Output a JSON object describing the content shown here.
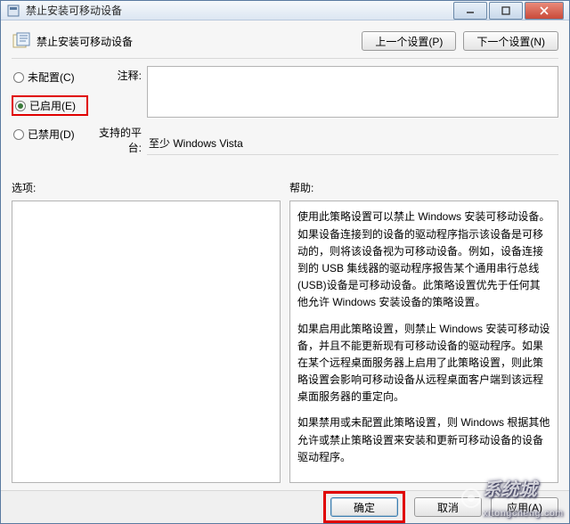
{
  "window": {
    "title": "禁止安装可移动设备"
  },
  "header": {
    "title": "禁止安装可移动设备",
    "prev_btn": "上一个设置(P)",
    "next_btn": "下一个设置(N)"
  },
  "radios": {
    "not_configured": "未配置(C)",
    "enabled": "已启用(E)",
    "disabled": "已禁用(D)",
    "selected": "enabled"
  },
  "fields": {
    "comment_label": "注释:",
    "comment_value": "",
    "platform_label": "支持的平台:",
    "platform_value": "至少 Windows Vista"
  },
  "lower": {
    "options_label": "选项:",
    "help_label": "帮助:",
    "help_paragraphs": [
      "使用此策略设置可以禁止 Windows 安装可移动设备。如果设备连接到的设备的驱动程序指示该设备是可移动的，则将该设备视为可移动设备。例如，设备连接到的 USB 集线器的驱动程序报告某个通用串行总线(USB)设备是可移动设备。此策略设置优先于任何其他允许 Windows 安装设备的策略设置。",
      "如果启用此策略设置，则禁止 Windows 安装可移动设备，并且不能更新现有可移动设备的驱动程序。如果在某个远程桌面服务器上启用了此策略设置，则此策略设置会影响可移动设备从远程桌面客户端到该远程桌面服务器的重定向。",
      "如果禁用或未配置此策略设置，则 Windows 根据其他允许或禁止策略设置来安装和更新可移动设备的设备驱动程序。"
    ]
  },
  "footer": {
    "ok": "确定",
    "cancel": "取消",
    "apply": "应用(A)"
  },
  "watermark": {
    "brand_cn": "系统城",
    "brand_url": "xitongcheng.com"
  }
}
